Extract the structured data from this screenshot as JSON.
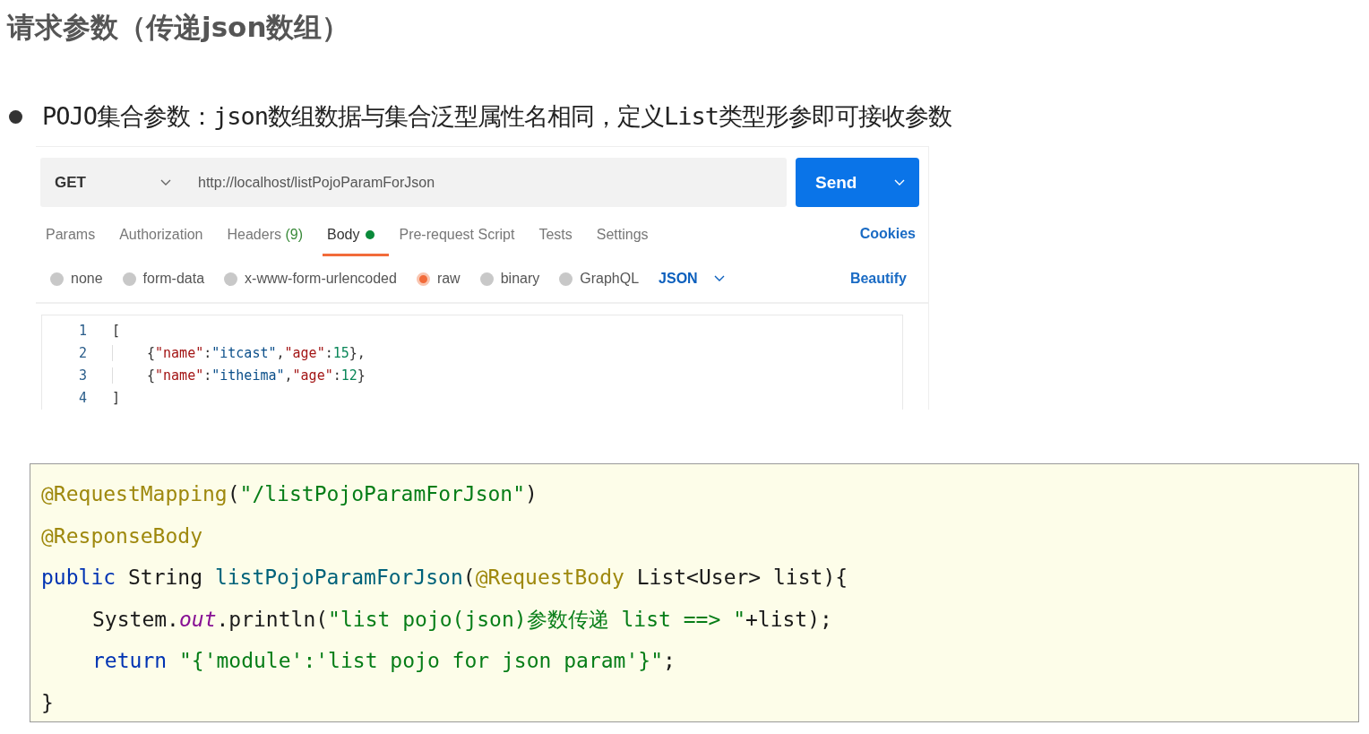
{
  "title": "请求参数（传递json数组）",
  "bullet": "POJO集合参数：json数组数据与集合泛型属性名相同，定义List类型形参即可接收参数",
  "postman": {
    "method": "GET",
    "url": "http://localhost/listPojoParamForJson",
    "send": "Send",
    "tabs": [
      {
        "label": "Params",
        "selected": false,
        "dot": false
      },
      {
        "label": "Authorization",
        "selected": false,
        "dot": false
      },
      {
        "label": "Headers",
        "count": "(9)",
        "selected": false,
        "dot": false
      },
      {
        "label": "Body",
        "selected": true,
        "dot": true
      },
      {
        "label": "Pre-request Script",
        "selected": false,
        "dot": false
      },
      {
        "label": "Tests",
        "selected": false,
        "dot": false
      },
      {
        "label": "Settings",
        "selected": false,
        "dot": false
      }
    ],
    "cookies": "Cookies",
    "body_types": [
      {
        "label": "none",
        "selected": false
      },
      {
        "label": "form-data",
        "selected": false
      },
      {
        "label": "x-www-form-urlencoded",
        "selected": false
      },
      {
        "label": "raw",
        "selected": true
      },
      {
        "label": "binary",
        "selected": false
      },
      {
        "label": "GraphQL",
        "selected": false
      }
    ],
    "format": "JSON",
    "beautify": "Beautify",
    "editor_lines": [
      {
        "number": "1",
        "indent": false,
        "tokens": [
          {
            "text": "[",
            "kind": "punct"
          }
        ]
      },
      {
        "number": "2",
        "indent": true,
        "tokens": [
          {
            "text": "{",
            "kind": "punct"
          },
          {
            "text": "\"name\"",
            "kind": "key"
          },
          {
            "text": ":",
            "kind": "punct"
          },
          {
            "text": "\"itcast\"",
            "kind": "string"
          },
          {
            "text": ",",
            "kind": "punct"
          },
          {
            "text": "\"age\"",
            "kind": "key"
          },
          {
            "text": ":",
            "kind": "punct"
          },
          {
            "text": "15",
            "kind": "number"
          },
          {
            "text": "},",
            "kind": "punct"
          }
        ]
      },
      {
        "number": "3",
        "indent": true,
        "tokens": [
          {
            "text": "{",
            "kind": "punct"
          },
          {
            "text": "\"name\"",
            "kind": "key"
          },
          {
            "text": ":",
            "kind": "punct"
          },
          {
            "text": "\"itheima\"",
            "kind": "string"
          },
          {
            "text": ",",
            "kind": "punct"
          },
          {
            "text": "\"age\"",
            "kind": "key"
          },
          {
            "text": ":",
            "kind": "punct"
          },
          {
            "text": "12",
            "kind": "number"
          },
          {
            "text": "}",
            "kind": "punct"
          }
        ]
      },
      {
        "number": "4",
        "indent": false,
        "tokens": [
          {
            "text": "]",
            "kind": "punct"
          }
        ]
      }
    ]
  },
  "code_lines": [
    {
      "indent": false,
      "tokens": [
        {
          "text": "@RequestMapping",
          "kind": "annotation"
        },
        {
          "text": "(",
          "kind": "plain"
        },
        {
          "text": "\"/listPojoParamForJson\"",
          "kind": "string"
        },
        {
          "text": ")",
          "kind": "plain"
        }
      ]
    },
    {
      "indent": false,
      "tokens": [
        {
          "text": "@ResponseBody",
          "kind": "annotation"
        }
      ]
    },
    {
      "indent": false,
      "tokens": [
        {
          "text": "public",
          "kind": "keyword"
        },
        {
          "text": " String ",
          "kind": "plain"
        },
        {
          "text": "listPojoParamForJson",
          "kind": "method"
        },
        {
          "text": "(",
          "kind": "plain"
        },
        {
          "text": "@RequestBody",
          "kind": "annotation"
        },
        {
          "text": " List<User> list){",
          "kind": "plain"
        }
      ]
    },
    {
      "indent": true,
      "tokens": [
        {
          "text": "System.",
          "kind": "plain"
        },
        {
          "text": "out",
          "kind": "field"
        },
        {
          "text": ".println(",
          "kind": "plain"
        },
        {
          "text": "\"list pojo(json)参数传递 list ==> \"",
          "kind": "string"
        },
        {
          "text": "+list);",
          "kind": "plain"
        }
      ]
    },
    {
      "indent": true,
      "tokens": [
        {
          "text": "return",
          "kind": "keyword"
        },
        {
          "text": " \"{'module':'list pojo for json param'}\"",
          "kind": "string"
        },
        {
          "text": ";",
          "kind": "plain"
        }
      ]
    },
    {
      "indent": false,
      "tokens": [
        {
          "text": "}",
          "kind": "plain"
        }
      ]
    }
  ]
}
